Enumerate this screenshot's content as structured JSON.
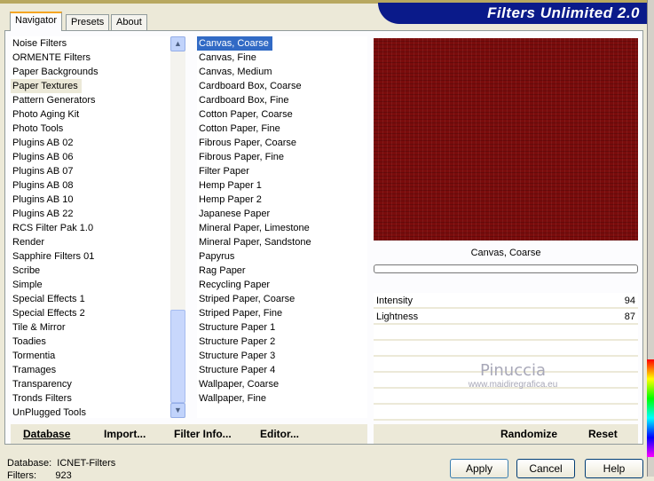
{
  "title": "Filters Unlimited 2.0",
  "tabs": [
    "Navigator",
    "Presets",
    "About"
  ],
  "categories": [
    "Noise Filters",
    "ORMENTE Filters",
    "Paper Backgrounds",
    "Paper Textures",
    "Pattern Generators",
    "Photo Aging Kit",
    "Photo Tools",
    "Plugins AB 02",
    "Plugins AB 06",
    "Plugins AB 07",
    "Plugins AB 08",
    "Plugins AB 10",
    "Plugins AB 22",
    "RCS Filter Pak 1.0",
    "Render",
    "Sapphire Filters 01",
    "Scribe",
    "Simple",
    "Special Effects 1",
    "Special Effects 2",
    "Tile & Mirror",
    "Toadies",
    "Tormentia",
    "Tramages",
    "Transparency",
    "Tronds Filters",
    "UnPlugged Tools"
  ],
  "selected_category": "Paper Textures",
  "filters": [
    "Canvas, Coarse",
    "Canvas, Fine",
    "Canvas, Medium",
    "Cardboard Box, Coarse",
    "Cardboard Box, Fine",
    "Cotton Paper, Coarse",
    "Cotton Paper, Fine",
    "Fibrous Paper, Coarse",
    "Fibrous Paper, Fine",
    "Filter Paper",
    "Hemp Paper 1",
    "Hemp Paper 2",
    "Japanese Paper",
    "Mineral Paper, Limestone",
    "Mineral Paper, Sandstone",
    "Papyrus",
    "Rag Paper",
    "Recycling Paper",
    "Striped Paper, Coarse",
    "Striped Paper, Fine",
    "Structure Paper 1",
    "Structure Paper 2",
    "Structure Paper 3",
    "Structure Paper 4",
    "Wallpaper, Coarse",
    "Wallpaper, Fine"
  ],
  "selected_filter": "Canvas, Coarse",
  "preview_name": "Canvas, Coarse",
  "params": [
    {
      "label": "Intensity",
      "value": "94"
    },
    {
      "label": "Lightness",
      "value": "87"
    }
  ],
  "watermark": {
    "name": "Pinuccia",
    "url": "www.maidiregrafica.eu"
  },
  "left_buttons": [
    "Database",
    "Import...",
    "Filter Info...",
    "Editor..."
  ],
  "right_buttons": [
    "Randomize",
    "Reset"
  ],
  "status": {
    "database_label": "Database:",
    "database_value": "ICNET-Filters",
    "filters_label": "Filters:",
    "filters_value": "923"
  },
  "dialog_buttons": [
    "Apply",
    "Cancel",
    "Help"
  ]
}
